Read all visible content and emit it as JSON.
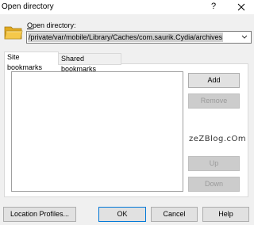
{
  "window": {
    "title": "Open directory",
    "help_glyph": "?",
    "close_glyph": "✕"
  },
  "directory": {
    "label_access": "O",
    "label_rest": "pen directory:",
    "value": "/private/var/mobile/Library/Caches/com.saurik.Cydia/archives"
  },
  "tabs": [
    {
      "label": "Site bookmarks",
      "active": true
    },
    {
      "label": "Shared bookmarks",
      "active": false
    }
  ],
  "buttons": {
    "add": "Add",
    "remove": "Remove",
    "up": "Up",
    "down": "Down",
    "location_profiles": "Location Profiles...",
    "ok": "OK",
    "cancel": "Cancel",
    "help": "Help"
  },
  "watermark": "zeZBlog.cOm",
  "colors": {
    "accent": "#0078d7",
    "folder": "#f5c84a"
  }
}
